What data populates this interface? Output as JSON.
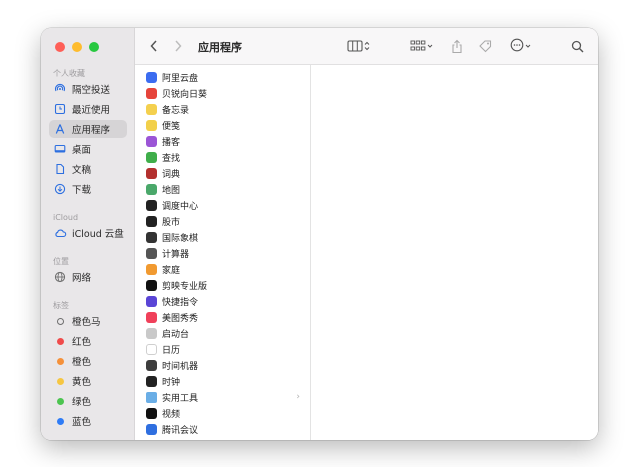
{
  "window": {
    "title": "应用程序",
    "colors": {
      "sidebar_bg": "#e9e7e9",
      "selection": "#d6d4d6",
      "accent": "#2d6fe0"
    }
  },
  "toolbar": {
    "back_icon": "chevron-left-icon",
    "forward_icon": "chevron-right-icon",
    "view_icon": "column-view-icon",
    "group_icon": "grid-group-icon",
    "share_icon": "share-icon",
    "tag_icon": "tag-icon",
    "more_icon": "ellipsis-circle-icon",
    "search_icon": "search-icon"
  },
  "sidebar": {
    "favorites_header": "个人收藏",
    "favorites": [
      {
        "label": "隔空投送",
        "icon": "airdrop-icon"
      },
      {
        "label": "最近使用",
        "icon": "recents-icon"
      },
      {
        "label": "应用程序",
        "icon": "applications-icon",
        "selected": true
      },
      {
        "label": "桌面",
        "icon": "desktop-icon"
      },
      {
        "label": "文稿",
        "icon": "document-icon"
      },
      {
        "label": "下载",
        "icon": "download-icon"
      }
    ],
    "icloud_header": "iCloud",
    "icloud": [
      {
        "label": "iCloud 云盘",
        "icon": "cloud-icon"
      }
    ],
    "location_header": "位置",
    "locations": [
      {
        "label": "网络",
        "icon": "network-globe-icon"
      }
    ],
    "tags_header": "标签",
    "tags": [
      {
        "label": "橙色马",
        "color": "#6e6e6e"
      },
      {
        "label": "红色",
        "color": "#f04b4b"
      },
      {
        "label": "橙色",
        "color": "#f5913a"
      },
      {
        "label": "黄色",
        "color": "#f6c642"
      },
      {
        "label": "绿色",
        "color": "#4cc450"
      },
      {
        "label": "蓝色",
        "color": "#2f7cf6"
      }
    ]
  },
  "applications": [
    {
      "name": "阿里云盘",
      "color": "#3b6cf0"
    },
    {
      "name": "贝锐向日葵",
      "color": "#e6443b"
    },
    {
      "name": "备忘录",
      "color": "#f4d04e"
    },
    {
      "name": "便笺",
      "color": "#f2d04a"
    },
    {
      "name": "播客",
      "color": "#9b55d6"
    },
    {
      "name": "查找",
      "color": "#3fae4a"
    },
    {
      "name": "词典",
      "color": "#b3302e"
    },
    {
      "name": "地图",
      "color": "#4aa86a"
    },
    {
      "name": "调度中心",
      "color": "#222222"
    },
    {
      "name": "股市",
      "color": "#222222"
    },
    {
      "name": "国际象棋",
      "color": "#333333"
    },
    {
      "name": "计算器",
      "color": "#555555"
    },
    {
      "name": "家庭",
      "color": "#f19a30"
    },
    {
      "name": "剪映专业版",
      "color": "#111111"
    },
    {
      "name": "快捷指令",
      "color": "#5a45d6"
    },
    {
      "name": "美图秀秀",
      "color": "#f0405a"
    },
    {
      "name": "启动台",
      "color": "#c9c9c9"
    },
    {
      "name": "日历",
      "color": "#ffffff"
    },
    {
      "name": "时间机器",
      "color": "#3d3d3d"
    },
    {
      "name": "时钟",
      "color": "#222222"
    },
    {
      "name": "实用工具",
      "color": "#6aaee6",
      "folder": true
    },
    {
      "name": "视频",
      "color": "#111111"
    },
    {
      "name": "腾讯会议",
      "color": "#2f6fe0"
    }
  ]
}
